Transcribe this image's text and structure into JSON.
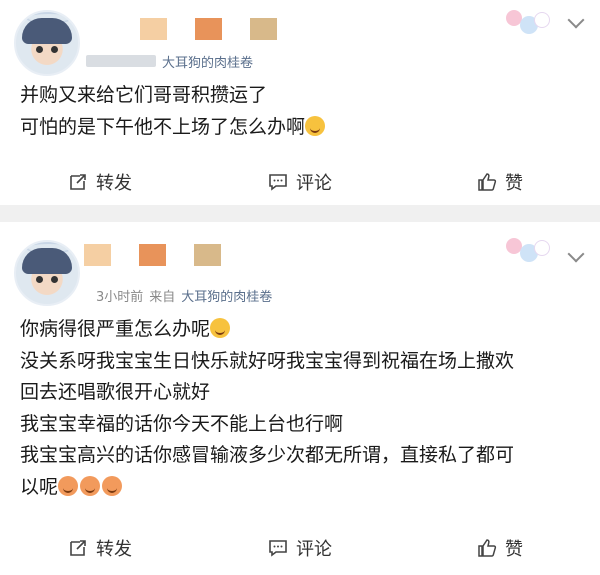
{
  "colors": {
    "block_orange": "#e8935a",
    "block_tan": "#d8b98a",
    "block_peach": "#f5cfa3",
    "block_gray": "#d9dde2",
    "source_blue": "#5a6f8c",
    "divider": "#f0f0f0"
  },
  "posts": [
    {
      "meta": {
        "source": "大耳狗的肉桂卷"
      },
      "content": [
        "并购又来给它们哥哥积攒运了",
        "可怕的是下午他不上场了怎么办啊"
      ],
      "actions": {
        "repost": "转发",
        "comment": "评论",
        "like": "赞"
      }
    },
    {
      "meta": {
        "time": "3小时前",
        "source_prefix": "来自",
        "source": "大耳狗的肉桂卷"
      },
      "content": [
        "你病得很严重怎么办呢",
        "没关系呀我宝宝生日快乐就好呀我宝宝得到祝福在场上撒欢",
        "回去还唱歌很开心就好",
        "我宝宝幸福的话你今天不能上台也行啊",
        "我宝宝高兴的话你感冒输液多少次都无所谓，直接私了都可",
        "以呢"
      ],
      "actions": {
        "repost": "转发",
        "comment": "评论",
        "like": "赞"
      }
    }
  ],
  "icons": {
    "repost": "repost-icon",
    "comment": "comment-icon",
    "like": "thumbs-up-icon",
    "menu": "chevron-down-icon"
  }
}
